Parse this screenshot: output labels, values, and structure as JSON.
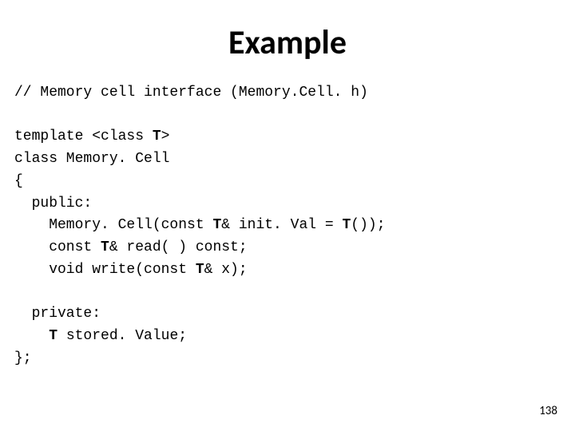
{
  "title": "Example",
  "code": {
    "l1a": "// Memory cell interface (Memory.Cell. h)",
    "l2a": "template <class ",
    "l2b": "T",
    "l2c": ">",
    "l3a": "class Memory. Cell",
    "l4a": "{",
    "l5a": "public:",
    "l6a": "Memory. Cell(const ",
    "l6b": "T",
    "l6c": "& init. Val = ",
    "l6d": "T",
    "l6e": "());",
    "l7a": "const ",
    "l7b": "T",
    "l7c": "& read( ) const;",
    "l8a": "void write(const ",
    "l8b": "T",
    "l8c": "& x);",
    "l9a": "private:",
    "l10a": "T",
    "l10b": " stored. Value;",
    "l11a": "};"
  },
  "page_number": "138"
}
